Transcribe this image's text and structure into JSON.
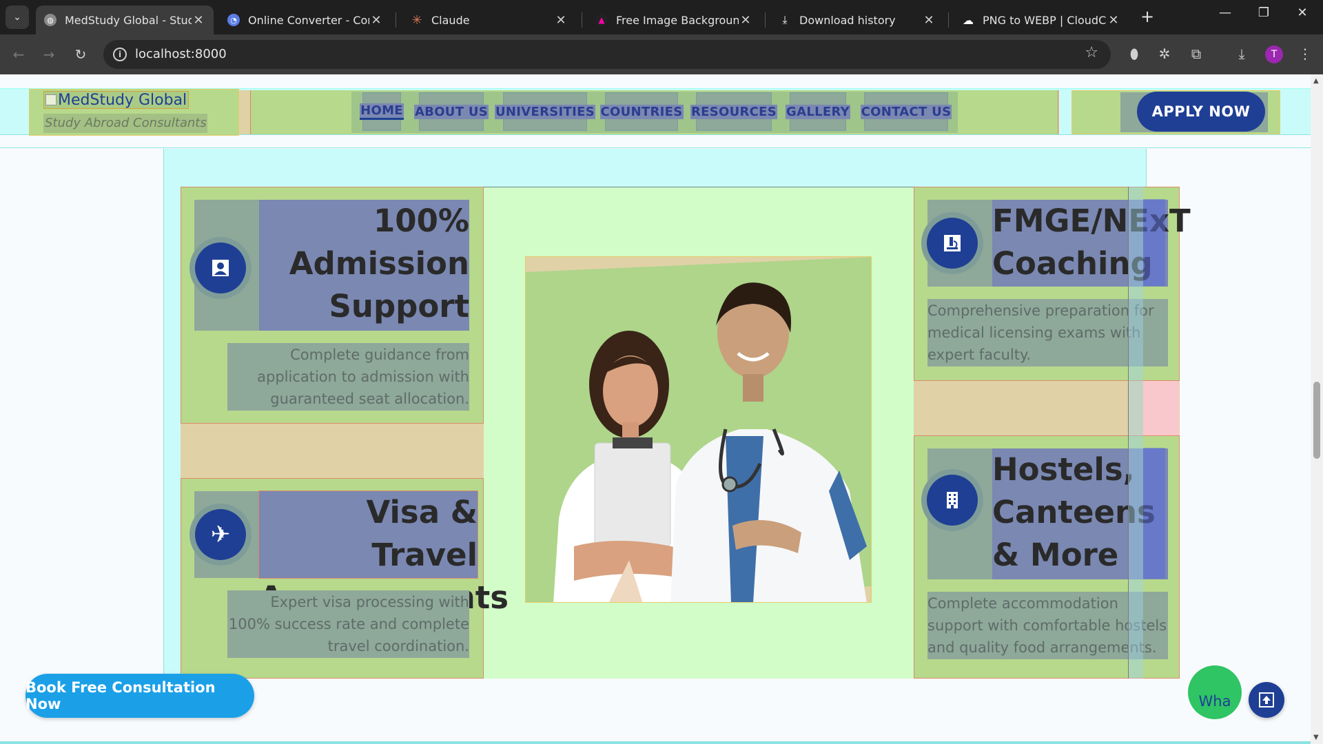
{
  "browser": {
    "tabs": [
      {
        "title": "MedStudy Global - Study M",
        "active": true
      },
      {
        "title": "Online Converter - Convert",
        "active": false
      },
      {
        "title": "Claude",
        "active": false
      },
      {
        "title": "Free Image Background Re",
        "active": false
      },
      {
        "title": "Download history",
        "active": false
      },
      {
        "title": "PNG to WEBP | CloudConv",
        "active": false
      }
    ],
    "url": "localhost:8000",
    "profile_initial": "T"
  },
  "header": {
    "logo_alt": "MedStudy Global",
    "tagline": "Study Abroad Consultants",
    "nav": [
      "HOME",
      "ABOUT US",
      "UNIVERSITIES",
      "COUNTRIES",
      "RESOURCES",
      "GALLERY",
      "CONTACT US"
    ],
    "active_nav": "HOME",
    "apply_label": "APPLY NOW"
  },
  "features": {
    "left": [
      {
        "title": "100% Admission Support",
        "desc": "Complete guidance from application to admission with guaranteed seat allocation.",
        "icon": "user-card-icon"
      },
      {
        "title": "Visa & Travel Arrangements",
        "desc": "Expert visa processing with 100% success rate and complete travel coordination.",
        "icon": "plane-icon"
      }
    ],
    "right": [
      {
        "title": "FMGE/NExT Coaching",
        "desc": "Comprehensive preparation for medical licensing exams with expert faculty.",
        "icon": "microscope-icon"
      },
      {
        "title": "Hostels, Canteens & More",
        "desc": "Complete accommodation support with comfortable hostels and quality food arrangements.",
        "icon": "building-icon"
      }
    ]
  },
  "floating": {
    "consult_label": "Book Free Consultation Now",
    "whatsapp_alt": "Wha"
  },
  "colors": {
    "brand_navy": "#1f3f95",
    "cta_blue": "#1ba0e8",
    "whatsapp_green": "#2fc464"
  }
}
